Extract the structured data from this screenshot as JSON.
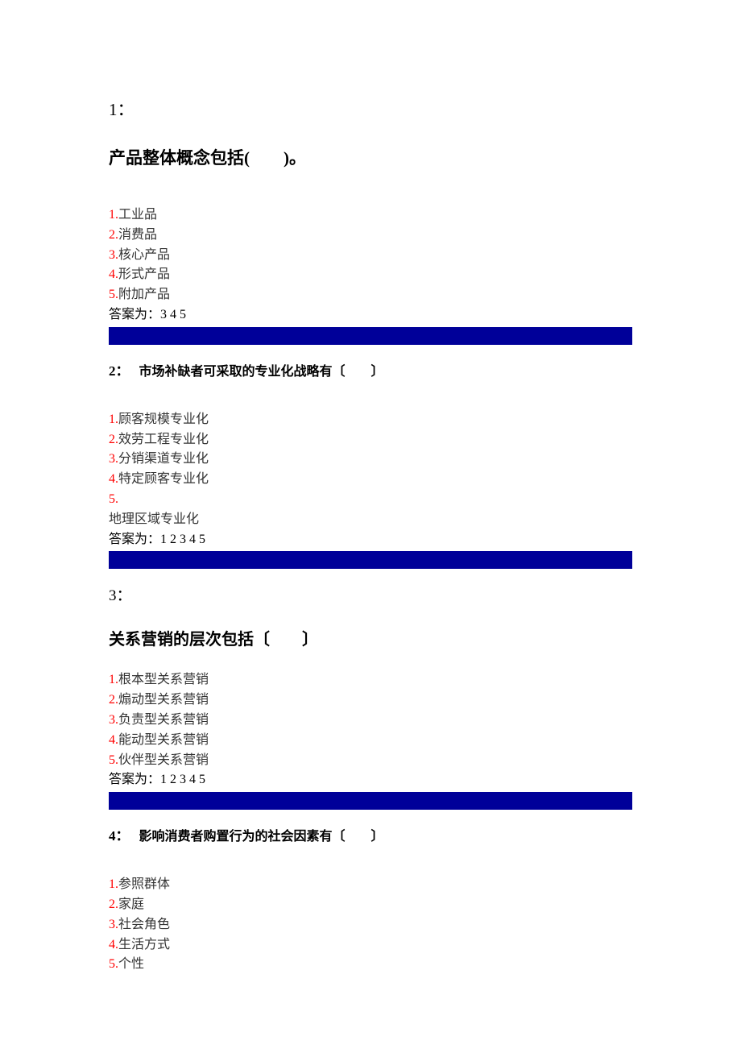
{
  "questions": [
    {
      "number": "1：",
      "title": "产品整体概念包括(　　)。",
      "options": [
        {
          "num": "1.",
          "text": "工业品"
        },
        {
          "num": "2.",
          "text": "消费品"
        },
        {
          "num": "3.",
          "text": "核心产品"
        },
        {
          "num": "4.",
          "text": "形式产品"
        },
        {
          "num": "5.",
          "text": "附加产品"
        }
      ],
      "answer": "答案为：3 4 5"
    },
    {
      "number": "2：",
      "title": "市场补缺者可采取的专业化战略有〔　　〕",
      "options": [
        {
          "num": "1.",
          "text": "顾客规模专业化"
        },
        {
          "num": "2.",
          "text": "效劳工程专业化"
        },
        {
          "num": "3.",
          "text": "分销渠道专业化"
        },
        {
          "num": "4.",
          "text": "特定顾客专业化"
        },
        {
          "num": "5.",
          "text": "",
          "extra": "地理区域专业化"
        }
      ],
      "answer": "答案为：1 2 3 4 5"
    },
    {
      "number": "3：",
      "title": "关系营销的层次包括〔　　〕",
      "options": [
        {
          "num": "1.",
          "text": "根本型关系营销"
        },
        {
          "num": "2.",
          "text": "煽动型关系营销"
        },
        {
          "num": "3.",
          "text": "负责型关系营销"
        },
        {
          "num": "4.",
          "text": "能动型关系营销"
        },
        {
          "num": "5.",
          "text": "伙伴型关系营销"
        }
      ],
      "answer": "答案为：1 2 3 4 5"
    },
    {
      "number": "4：",
      "title": "影响消费者购置行为的社会因素有〔　　〕",
      "options": [
        {
          "num": "1.",
          "text": "参照群体"
        },
        {
          "num": "2.",
          "text": "家庭"
        },
        {
          "num": "3.",
          "text": "社会角色"
        },
        {
          "num": "4.",
          "text": "生活方式"
        },
        {
          "num": "5.",
          "text": "个性"
        }
      ]
    }
  ]
}
